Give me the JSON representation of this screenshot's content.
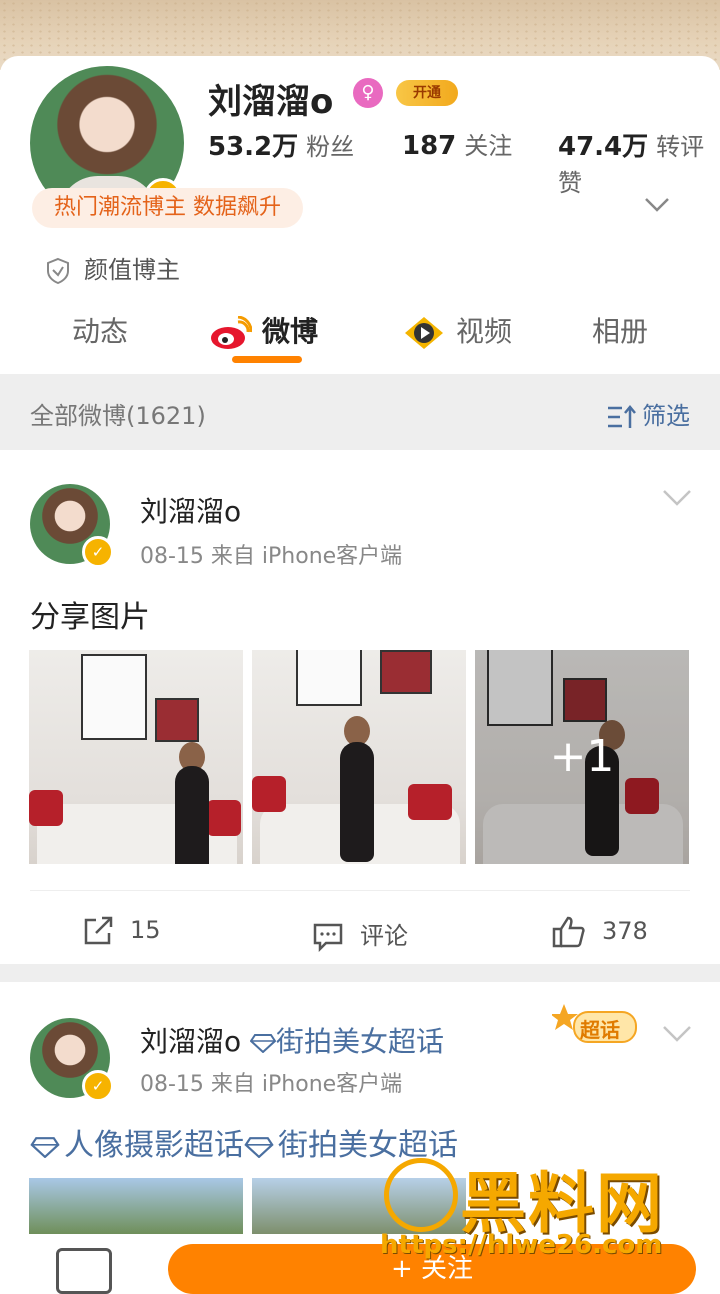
{
  "profile": {
    "name": "刘溜溜o",
    "vip_label": "开通",
    "followers_value": "53.2万",
    "followers_label": "粉丝",
    "following_value": "187",
    "following_label": "关注",
    "likes_value": "47.4万",
    "likes_label": "转评赞",
    "hot_tag": "热门潮流博主 数据飙升",
    "category_tag": "颜值博主"
  },
  "tabs": [
    {
      "label": "动态"
    },
    {
      "label": "微博"
    },
    {
      "label": "视频"
    },
    {
      "label": "相册"
    }
  ],
  "filterbar": {
    "count": "全部微博(1621)",
    "filter_label": "筛选"
  },
  "posts": [
    {
      "author": "刘溜溜o",
      "meta": "08-15  来自 iPhone客户端",
      "text": "分享图片",
      "more_count": "+1",
      "repost": "15",
      "comment": "评论",
      "likes": "378"
    },
    {
      "author": "刘溜溜o",
      "author_topic": "街拍美女超话",
      "meta": "08-15  来自 iPhone客户端",
      "topic1": "人像摄影超话",
      "topic2": "街拍美女超话",
      "sticker": "超话"
    }
  ],
  "bottom": {
    "follow_label": "+ 关注"
  },
  "watermark": {
    "text": "黑料网",
    "url": "https://hlwe26.com"
  },
  "colors": {
    "accent": "#ff8200",
    "verified": "#f6b300",
    "link": "#4a6fa0"
  }
}
